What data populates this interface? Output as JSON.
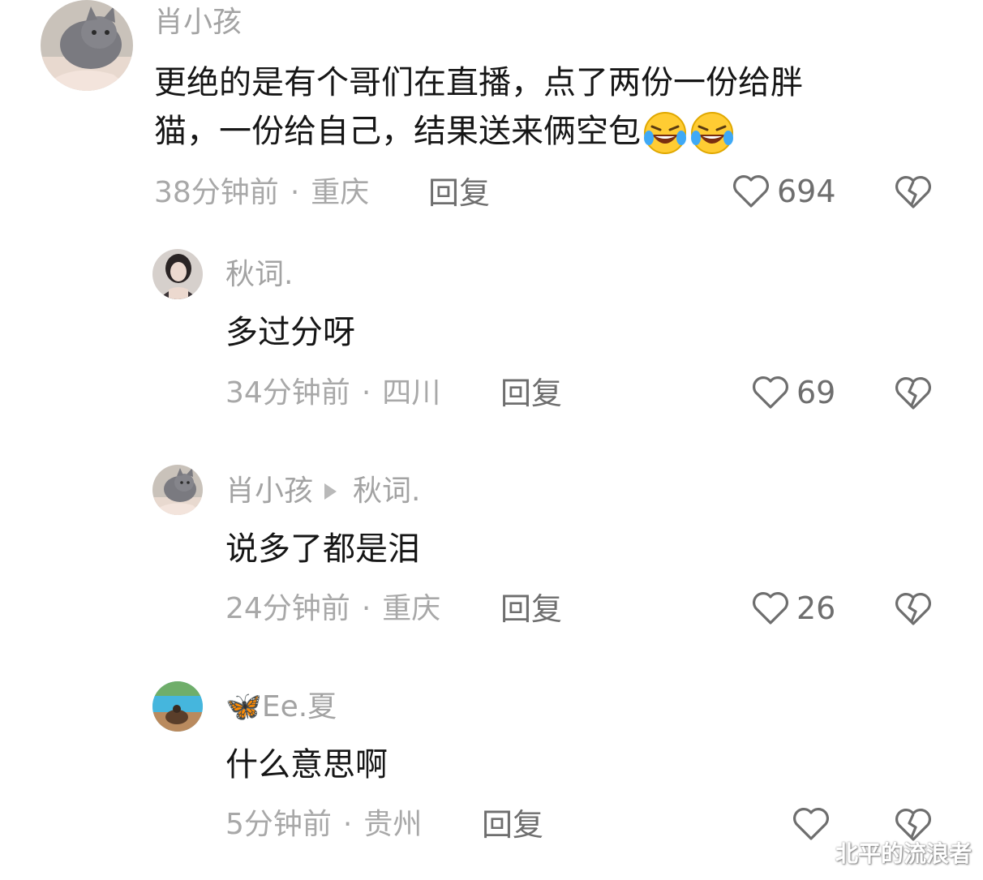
{
  "comment": {
    "username": "肖小孩",
    "text_line1": "更绝的是有个哥们在直播，点了两份一份给胖",
    "text_line2": "猫，一份给自己，结果送来俩空包",
    "emoji": "rofl-emoji",
    "time": "38分钟前",
    "dot": "·",
    "location": "重庆",
    "reply_label": "回复",
    "likes": "694"
  },
  "replies": [
    {
      "username": "秋词.",
      "text": "多过分呀",
      "time": "34分钟前",
      "dot": "·",
      "location": "四川",
      "reply_label": "回复",
      "likes": "69"
    },
    {
      "username": "肖小孩",
      "reply_to": "秋词.",
      "text": "说多了都是泪",
      "time": "24分钟前",
      "dot": "·",
      "location": "重庆",
      "reply_label": "回复",
      "likes": "26"
    },
    {
      "username": "🦋Ee.夏",
      "text": "什么意思啊",
      "time": "5分钟前",
      "dot": "·",
      "location": "贵州",
      "reply_label": "回复",
      "likes": ""
    }
  ],
  "icons": {
    "like": "heart-outline-icon",
    "dislike": "broken-heart-icon",
    "reply_arrow": "play-arrow-icon"
  },
  "watermark": "北平的流浪者",
  "colors": {
    "username": "#a3a3a3",
    "text": "#161616",
    "meta": "#a8a8a8",
    "action": "#6e6e6e"
  }
}
